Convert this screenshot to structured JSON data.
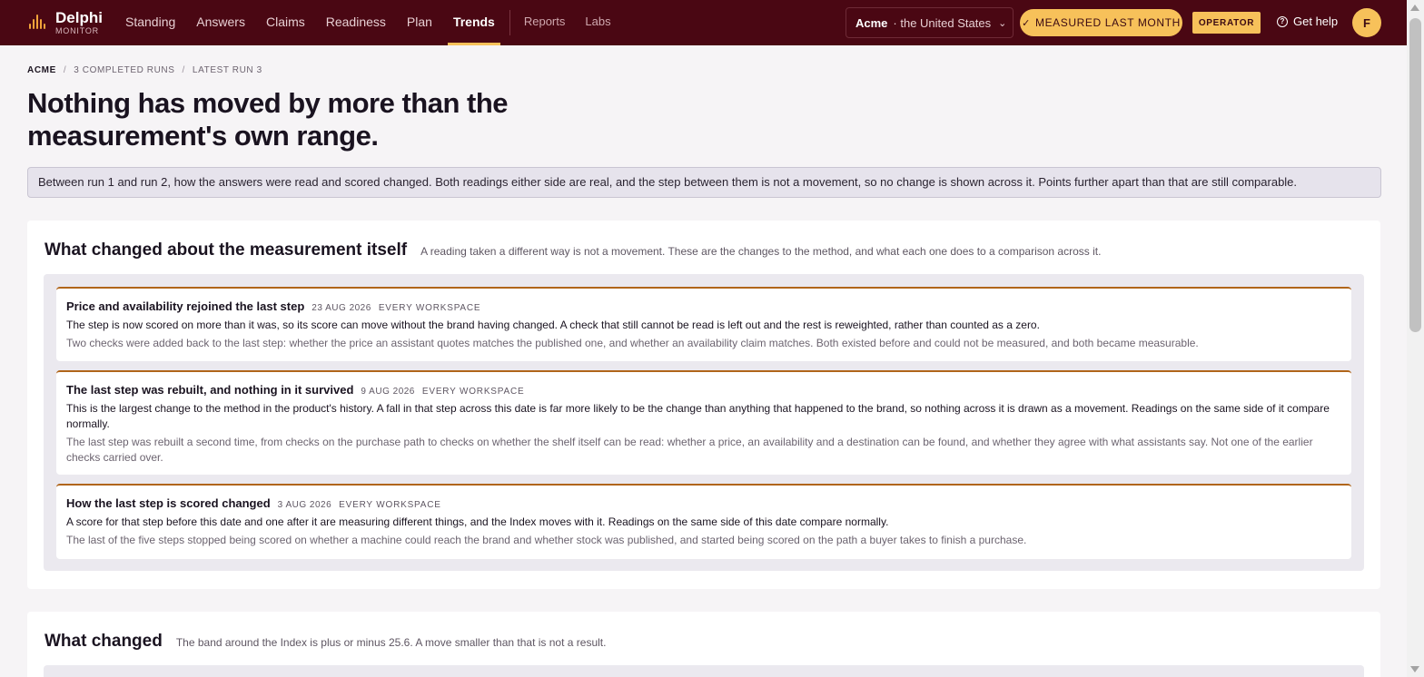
{
  "brand": {
    "name": "Delphi",
    "sub": "MONITOR"
  },
  "nav": {
    "items": [
      "Standing",
      "Answers",
      "Claims",
      "Readiness",
      "Plan",
      "Trends"
    ],
    "active": "Trends",
    "secondary": [
      "Reports",
      "Labs"
    ]
  },
  "workspace": {
    "name": "Acme",
    "country": "· the United States"
  },
  "measured_label": "MEASURED LAST MONTH",
  "operator_label": "OPERATOR",
  "help_label": "Get help",
  "avatar_initial": "F",
  "breadcrumb": [
    "ACME",
    "3 COMPLETED RUNS",
    "LATEST RUN 3"
  ],
  "page_title": "Nothing has moved by more than the measurement's own range.",
  "notice": "Between run 1 and run 2, how the answers were read and scored changed. Both readings either side are real, and the step between them is not a movement, so no change is shown across it. Points further apart than that are still comparable.",
  "method_section": {
    "title": "What changed about the measurement itself",
    "subtitle": "A reading taken a different way is not a movement. These are the changes to the method, and what each one does to a comparison across it.",
    "changes": [
      {
        "title": "Price and availability rejoined the last step",
        "date": "23 AUG 2026",
        "scope": "EVERY WORKSPACE",
        "effect": "The step is now scored on more than it was, so its score can move without the brand having changed. A check that still cannot be read is left out and the rest is reweighted, rather than counted as a zero.",
        "detail": "Two checks were added back to the last step: whether the price an assistant quotes matches the published one, and whether an availability claim matches. Both existed before and could not be measured, and both became measurable."
      },
      {
        "title": "The last step was rebuilt, and nothing in it survived",
        "date": "9 AUG 2026",
        "scope": "EVERY WORKSPACE",
        "effect": "This is the largest change to the method in the product's history. A fall in that step across this date is far more likely to be the change than anything that happened to the brand, so nothing across it is drawn as a movement. Readings on the same side of it compare normally.",
        "detail": "The last step was rebuilt a second time, from checks on the purchase path to checks on whether the shelf itself can be read: whether a price, an availability and a destination can be found, and whether they agree with what assistants say. Not one of the earlier checks carried over."
      },
      {
        "title": "How the last step is scored changed",
        "date": "3 AUG 2026",
        "scope": "EVERY WORKSPACE",
        "effect": "A score for that step before this date and one after it are measuring different things, and the Index moves with it. Readings on the same side of this date compare normally.",
        "detail": "The last of the five steps stopped being scored on whether a machine could reach the brand and whether stock was published, and started being scored on the path a buyer takes to finish a purchase."
      }
    ]
  },
  "what_changed": {
    "title": "What changed",
    "subtitle": "The band around the Index is plus or minus 25.6. A move smaller than that is not a result."
  }
}
